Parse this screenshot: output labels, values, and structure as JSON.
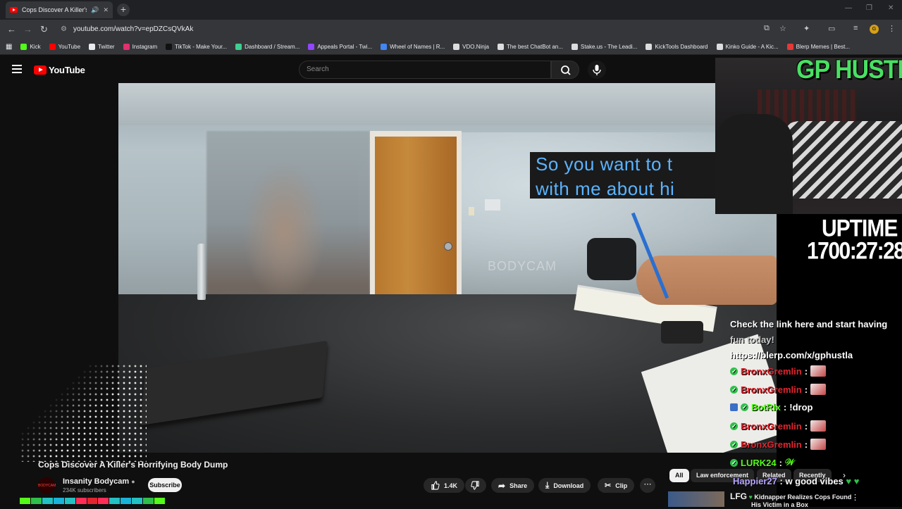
{
  "browser": {
    "tab_title": "Cops Discover A Killer's Ho",
    "url": "youtube.com/watch?v=epDZCsQVkAk",
    "bookmarks": [
      {
        "label": "Kick",
        "color": "#53fc18"
      },
      {
        "label": "YouTube",
        "color": "#ff0000"
      },
      {
        "label": "Twitter",
        "color": "#e8eaed"
      },
      {
        "label": "Instagram",
        "color": "#e1306c"
      },
      {
        "label": "TikTok - Make Your...",
        "color": "#111111"
      },
      {
        "label": "Dashboard / Stream...",
        "color": "#3ecf8e"
      },
      {
        "label": "Appeals Portal - Twi...",
        "color": "#9146ff"
      },
      {
        "label": "Wheel of Names | R...",
        "color": "#4285f4"
      },
      {
        "label": "VDO.Ninja",
        "color": "#dddddd"
      },
      {
        "label": "The best ChatBot an...",
        "color": "#dddddd"
      },
      {
        "label": "Stake.us - The Leadi...",
        "color": "#dddddd"
      },
      {
        "label": "KickTools Dashboard",
        "color": "#dddddd"
      },
      {
        "label": "Kinko Guide - A Kic...",
        "color": "#dddddd"
      },
      {
        "label": "Blerp Memes | Best...",
        "color": "#e53935"
      }
    ]
  },
  "youtube": {
    "logo_text": "YouTube",
    "search_placeholder": "Search",
    "video_title": "Cops Discover A Killer's Horrifying Body Dump",
    "channel_name": "Insanity Bodycam",
    "channel_avatar_text": "BODYCAM",
    "channel_subs": "234K subscribers",
    "subscribe_label": "Subscribe",
    "like_count": "1.4K",
    "share_label": "Share",
    "download_label": "Download",
    "clip_label": "Clip",
    "chips": [
      "All",
      "Law enforcement",
      "Related",
      "Recently"
    ],
    "rec_title_line1": "Kidnapper Realizes Cops Found",
    "rec_title_line2": "His Victim in a Box"
  },
  "video": {
    "subtitle_line1": "So you want to t",
    "subtitle_line2": "with me about hi",
    "watermark": "BODYCAM"
  },
  "overlay": {
    "streamer_name": "GP HUSTLA",
    "uptime_label": "UPTIME",
    "uptime_value": "1700:27:28",
    "promo_line1": "Check the link here and start having",
    "promo_line2": "fun today!",
    "promo_line3": "https://blerp.com/x/gphustla",
    "chat": [
      {
        "user": "BronxGremlin",
        "sep": ":",
        "msg": "",
        "color": "#e0252f",
        "emote": true,
        "bot": false
      },
      {
        "user": "BronxGremlin",
        "sep": ":",
        "msg": "",
        "color": "#e0252f",
        "emote": true,
        "bot": false
      },
      {
        "user": "BotRix",
        "sep": ":",
        "msg": "!drop",
        "color": "#53fc18",
        "emote": false,
        "bot": true
      },
      {
        "user": "BronxGremlin",
        "sep": ":",
        "msg": "",
        "color": "#e0252f",
        "emote": true,
        "bot": false
      },
      {
        "user": "BronxGremlin",
        "sep": ":",
        "msg": "",
        "color": "#e0252f",
        "emote": true,
        "bot": false
      },
      {
        "user": "LURK24",
        "sep": ":",
        "msg": "𝒲",
        "color": "#53fc18",
        "emote": false,
        "bot": false
      }
    ],
    "chat_last_user": "Happier27",
    "chat_last_msg": ": w good vibes",
    "chat_lfg": "LFG"
  },
  "colors": {
    "youtube_red": "#ff0000",
    "kick_green": "#53fc18",
    "subtitle_blue": "#5ab3ff"
  }
}
